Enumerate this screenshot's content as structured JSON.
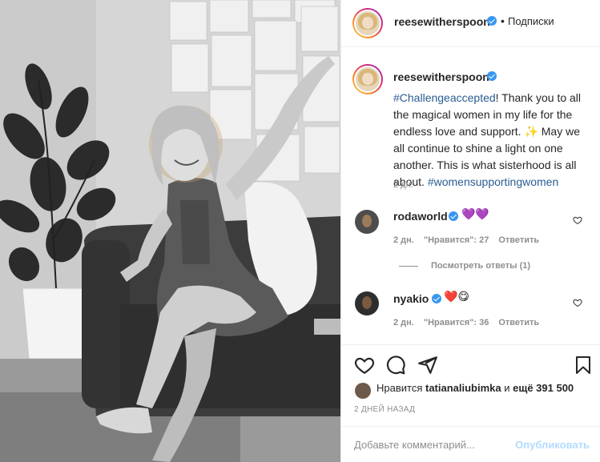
{
  "post": {
    "author": "reesewitherspoon",
    "separator": "•",
    "follow_label": "Подписки",
    "caption_tag1": "#Challengeaccepted",
    "caption_text1": "! Thank you to all the magical women in my life for the endless love and support. ✨ May we all continue to shine a light on one another. This is what sisterhood is all about. ",
    "caption_tag2": "#womensupportingwomen",
    "caption_time": "2 дн."
  },
  "comments": [
    {
      "user": "rodaworld",
      "emoji": "💜💜",
      "time": "2 дн.",
      "likes": "\"Нравится\": 27",
      "reply": "Ответить",
      "view_replies": "Посмотреть ответы (1)"
    },
    {
      "user": "nyakio",
      "emoji": "❤️😋",
      "time": "2 дн.",
      "likes": "\"Нравится\": 36",
      "reply": "Ответить"
    }
  ],
  "likes_line": {
    "prefix": "Нравится ",
    "user": "tatianaliubimka",
    "middle": " и ",
    "count": "ещё 391 500"
  },
  "date_label": "2 ДНЕЙ НАЗАД",
  "add_comment": {
    "placeholder": "Добавьте комментарий...",
    "publish": "Опубликовать"
  },
  "icons": {
    "like": "heart-icon",
    "comment": "comment-icon",
    "share": "share-icon",
    "save": "bookmark-icon",
    "verified": "verified-badge-icon"
  },
  "colors": {
    "verified": "#3897f0",
    "link": "#2a5d92",
    "muted": "#8e8e8e",
    "publish_disabled": "#b3dbff"
  }
}
